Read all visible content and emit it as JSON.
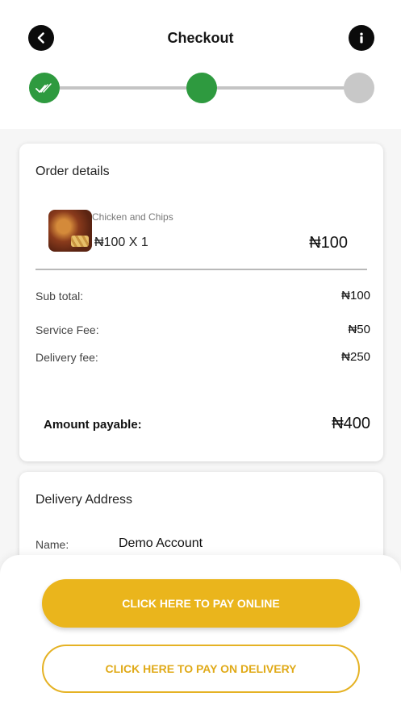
{
  "header": {
    "title": "Checkout",
    "back_icon": "chevron-left-icon",
    "info_icon": "info-icon"
  },
  "stepper": {
    "steps": [
      {
        "state": "completed",
        "icon": "double-check-icon"
      },
      {
        "state": "current"
      },
      {
        "state": "pending"
      }
    ],
    "colors": {
      "active": "#2e9a3f",
      "inactive": "#c8c8c8"
    }
  },
  "order": {
    "title": "Order details",
    "item": {
      "name": "Chicken and Chips",
      "qty": "₦100 X 1",
      "price": "₦100"
    },
    "subtotal": {
      "label": "Sub total:",
      "value": "₦100"
    },
    "service_fee": {
      "label": "Service Fee:",
      "value": "₦50"
    },
    "delivery_fee": {
      "label": "Delivery fee:",
      "value": "₦250"
    },
    "amount_payable": {
      "label": "Amount payable:",
      "value": "₦400"
    }
  },
  "address": {
    "title": "Delivery Address",
    "name_label": "Name:",
    "name_value": "Demo Account"
  },
  "actions": {
    "pay_online": "CLICK HERE TO PAY ONLINE",
    "pay_on_delivery": "CLICK HERE TO PAY ON DELIVERY",
    "accent": "#eab51c"
  }
}
